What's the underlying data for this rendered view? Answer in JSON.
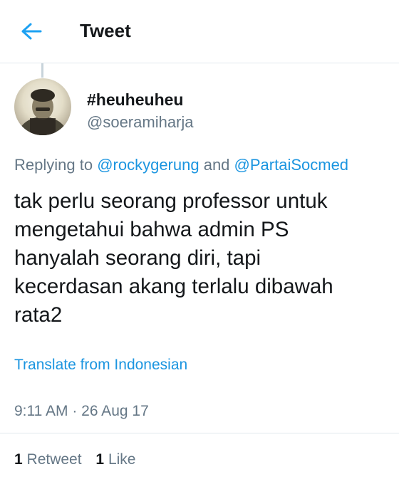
{
  "header": {
    "title": "Tweet",
    "back_icon": "arrow-left-icon",
    "accent_color": "#1da1f2"
  },
  "tweet": {
    "display_name": "#heuheuheu",
    "handle": "@soeramiharja",
    "replying_prefix": "Replying to ",
    "replying_mentions": [
      "@rockygerung",
      "@PartaiSocmed"
    ],
    "replying_connector": " and ",
    "text": "tak perlu seorang professor untuk\nmengetahui bahwa admin PS\nhanyalah seorang diri, tapi\nkecerdasan akang terlalu dibawah\nrata2",
    "translate_label": "Translate from Indonesian",
    "timestamp": "9:11 AM · 26 Aug 17"
  },
  "stats": {
    "retweets_count": "1",
    "retweets_label": "Retweet",
    "likes_count": "1",
    "likes_label": "Like"
  },
  "colors": {
    "link": "#1b95e0",
    "secondary_text": "#657786",
    "primary_text": "#14171a",
    "divider": "#e1e8ed"
  }
}
